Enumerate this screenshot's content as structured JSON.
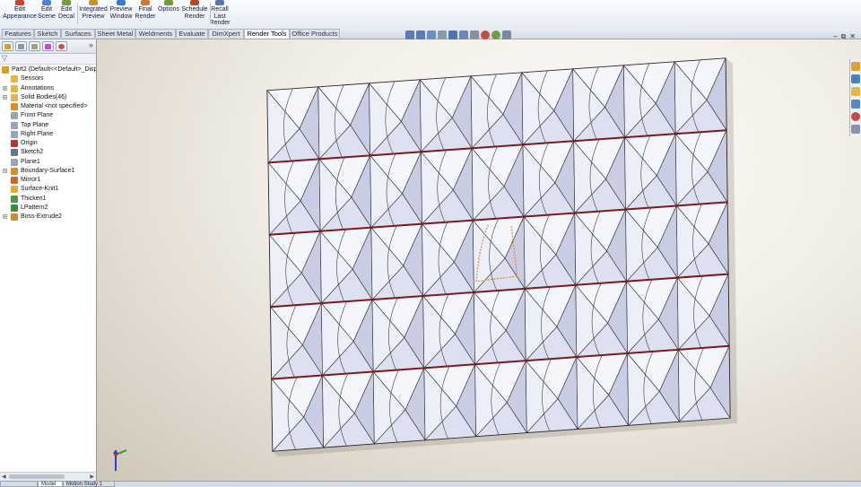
{
  "ribbon": {
    "buttons": [
      {
        "line1": "Edit",
        "line2": "Appearance",
        "line3": "",
        "icon": "appearance-icon",
        "color": "#c8452c"
      },
      {
        "line1": "Edit",
        "line2": "Scene",
        "line3": "",
        "icon": "scene-icon",
        "color": "#4f86c9"
      },
      {
        "line1": "Edit",
        "line2": "Decal",
        "line3": "",
        "icon": "decal-icon",
        "color": "#7a9b3a"
      },
      {
        "line1": "Integrated",
        "line2": "Preview",
        "line3": "",
        "icon": "integrated-preview-icon",
        "color": "#c9932b"
      },
      {
        "line1": "Preview",
        "line2": "Window",
        "line3": "",
        "icon": "preview-window-icon",
        "color": "#3a7bc8"
      },
      {
        "line1": "Final",
        "line2": "Render",
        "line3": "",
        "icon": "final-render-icon",
        "color": "#d1782a"
      },
      {
        "line1": "Options",
        "line2": "",
        "line3": "",
        "icon": "options-icon",
        "color": "#6f9c2f"
      },
      {
        "line1": "Schedule",
        "line2": "Render",
        "line3": "",
        "icon": "schedule-render-icon",
        "color": "#b2492e"
      },
      {
        "line1": "Recall",
        "line2": "Last",
        "line3": "Render",
        "icon": "recall-render-icon",
        "color": "#567ba8"
      }
    ]
  },
  "tabs": [
    "Features",
    "Sketch",
    "Surfaces",
    "Sheet Metal",
    "Weldments",
    "Evaluate",
    "DimXpert",
    "Render Tools",
    "Office Products"
  ],
  "active_tab": "Render Tools",
  "feature_manager": {
    "panel_tab_icons": [
      "feature-tree-icon",
      "property-manager-icon",
      "configuration-manager-icon",
      "dimxpert-manager-icon",
      "display-manager-icon"
    ],
    "more_glyph": "»",
    "filter_glyph": "▽",
    "tree": [
      {
        "label": "Part2  (Default<<Default>_Disp",
        "icon": "part-icon",
        "color": "#d6a21e",
        "expand": "",
        "indent": 0
      },
      {
        "label": "Sensors",
        "icon": "sensors-icon",
        "color": "#e0b54a",
        "expand": "",
        "indent": 1
      },
      {
        "label": "Annotations",
        "icon": "annotations-icon",
        "color": "#e3b63c",
        "expand": "+",
        "indent": 1
      },
      {
        "label": "Solid Bodies(46)",
        "icon": "solid-bodies-icon",
        "color": "#e0b54a",
        "expand": "+",
        "indent": 1
      },
      {
        "label": "Material <not specified>",
        "icon": "material-icon",
        "color": "#d98c2a",
        "expand": "",
        "indent": 1
      },
      {
        "label": "Front Plane",
        "icon": "plane-icon",
        "color": "#9aa4b3",
        "expand": "",
        "indent": 1
      },
      {
        "label": "Top Plane",
        "icon": "plane-icon",
        "color": "#9aa4b3",
        "expand": "",
        "indent": 1
      },
      {
        "label": "Right Plane",
        "icon": "plane-icon",
        "color": "#9aa4b3",
        "expand": "",
        "indent": 1
      },
      {
        "label": "Origin",
        "icon": "origin-icon",
        "color": "#b0383a",
        "expand": "",
        "indent": 1
      },
      {
        "label": "Sketch2",
        "icon": "sketch-icon",
        "color": "#6a7484",
        "expand": "",
        "indent": 1
      },
      {
        "label": "Plane1",
        "icon": "plane-icon",
        "color": "#9aa4b3",
        "expand": "",
        "indent": 1
      },
      {
        "label": "Boundary-Surface1",
        "icon": "boundary-surface-icon",
        "color": "#d8902d",
        "expand": "+",
        "indent": 1
      },
      {
        "label": "Mirror1",
        "icon": "mirror-icon",
        "color": "#c9663b",
        "expand": "",
        "indent": 1
      },
      {
        "label": "Surface-Knit1",
        "icon": "surface-knit-icon",
        "color": "#e0b033",
        "expand": "",
        "indent": 1
      },
      {
        "label": "Thicken1",
        "icon": "thicken-icon",
        "color": "#4a9a4a",
        "expand": "",
        "indent": 1
      },
      {
        "label": "LPattern2",
        "icon": "linear-pattern-icon",
        "color": "#3f8c3f",
        "expand": "",
        "indent": 1
      },
      {
        "label": "Boss-Extrude2",
        "icon": "boss-extrude-icon",
        "color": "#d28a2c",
        "expand": "+",
        "indent": 1
      }
    ]
  },
  "viewport": {
    "headsup_icons": [
      "zoom-to-fit-icon",
      "zoom-area-icon",
      "previous-view-icon",
      "section-view-icon",
      "view-orientation-icon",
      "display-style-icon",
      "hide-show-icon",
      "edit-appearance-icon",
      "apply-scene-icon",
      "view-settings-icon"
    ],
    "window_controls": [
      "–",
      "⧉",
      "✕"
    ],
    "task_pane_icons": [
      "resources-icon",
      "design-library-icon",
      "file-explorer-icon",
      "view-palette-icon",
      "appearances-icon",
      "custom-properties-icon"
    ],
    "model": {
      "rows": 5,
      "cols": 9,
      "face_color": "#e9ebf7",
      "edge_color": "#3a1212",
      "seam_color": "#7a1a1a",
      "selected_edge_color": "#e08a2a"
    }
  },
  "bottom_tabs": [
    "",
    "Model",
    "Motion Study 1"
  ],
  "active_bottom_tab": "Model"
}
